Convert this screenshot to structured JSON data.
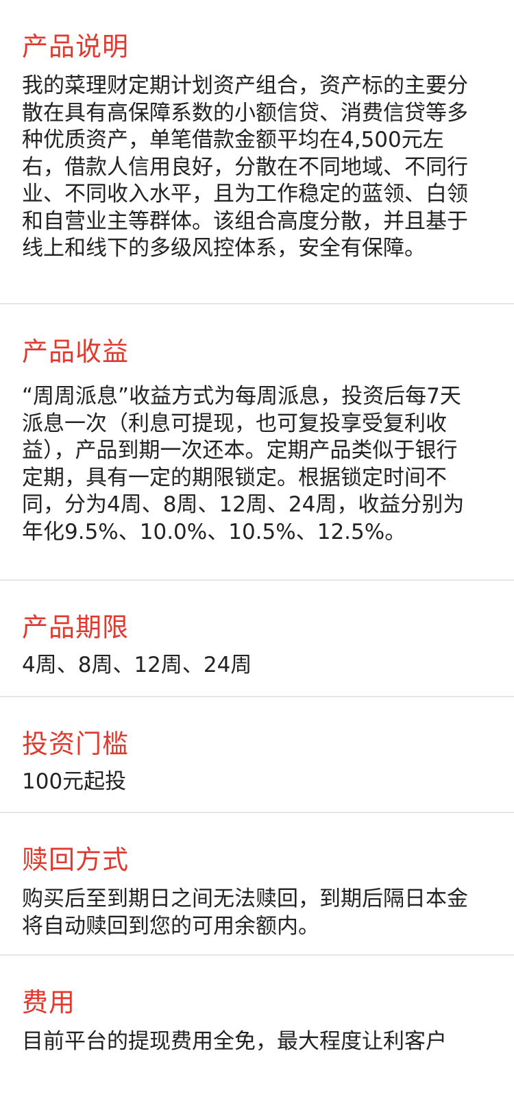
{
  "sections": [
    {
      "title": "产品说明",
      "body": "我的菜理财定期计划资产组合，资产标的主要分散在具有高保障系数的小额信贷、消费信贷等多种优质资产，单笔借款金额平均在4,500元左右，借款人信用良好，分散在不同地域、不同行业、不同收入水平，且为工作稳定的蓝领、白领和自营业主等群体。该组合高度分散，并且基于线上和线下的多级风控体系，安全有保障。"
    },
    {
      "title": "产品收益",
      "body": "“周周派息”收益方式为每周派息，投资后每7天派息一次（利息可提现，也可复投享受复利收益），产品到期一次还本。定期产品类似于银行定期，具有一定的期限锁定。根据锁定时间不同，分为4周、8周、12周、24周，收益分别为年化9.5%、10.0%、10.5%、12.5%。"
    },
    {
      "title": "产品期限",
      "body": "4周、8周、12周、24周"
    },
    {
      "title": "投资门槛",
      "body": "100元起投"
    },
    {
      "title": "赎回方式",
      "body": "购买后至到期日之间无法赎回，到期后隔日本金将自动赎回到您的可用余额内。"
    },
    {
      "title": "费用",
      "body": "目前平台的提现费用全免，最大程度让利客户"
    }
  ],
  "colors": {
    "accent": "#e03a2e",
    "text": "#222222",
    "divider": "#e5e5e5"
  }
}
